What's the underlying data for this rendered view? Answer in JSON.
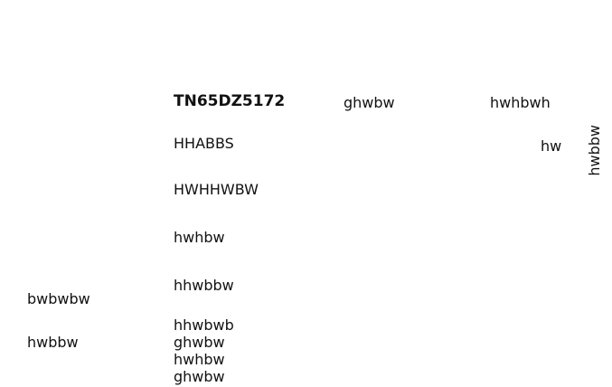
{
  "header": {
    "title": "TN65DZ5172",
    "col_a": "ghwbw",
    "col_b": "hwhbwh",
    "col_b_sub": "hw",
    "side_vertical": "hwbbw"
  },
  "center_list": {
    "items": [
      "HHABBS",
      "HWHHWBW",
      "hwhbw",
      "hhwbbw"
    ],
    "stack": [
      "hhwbwb",
      "ghwbw",
      "hwhbw",
      "ghwbw"
    ]
  },
  "left_list": {
    "items": [
      "bwbwbw",
      "hwbbw"
    ]
  }
}
